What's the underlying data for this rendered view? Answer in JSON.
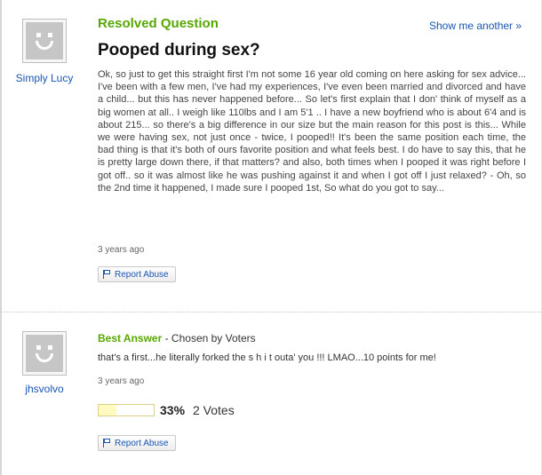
{
  "question": {
    "heading": "Resolved Question",
    "show_another": "Show me another »",
    "title": "Pooped during sex?",
    "asker": "Simply Lucy",
    "body": "Ok, so just to get this straight first I'm not some 16 year old coming on here asking for sex advice... I've been with a few men, I've had my experiences, I've even been married and divorced and have a child... but this has never happened before... So let's first explain that I don' think of myself as a big women at all.. I weigh like 110lbs and I am 5'1 .. I have a new boyfriend who is about 6'4 and is about 215... so there's a big difference in our size but the main reason for this post is this... While we were having sex, not just once - twice, I pooped!! It's been the same position each time, the bad thing is that it's both of ours favorite position and what feels best. I do have to say this, that he is pretty large down there, if that matters? and also, both times when I pooped it was right before I got off.. so it was almost like he was pushing against it and when I got off I just relaxed? - Oh, so the 2nd time it happened, I made sure I pooped 1st, So what do you got to say...",
    "time": "3 years ago",
    "report_label": "Report Abuse"
  },
  "best_answer": {
    "label": "Best Answer",
    "chosen_by": "- Chosen by Voters",
    "answerer": "jhsvolvo",
    "body": "that's a first...he literally forked the s h i t outa' you !!! LMAO...10 points for me!",
    "time": "3 years ago",
    "vote_percent_value": 0.33,
    "vote_percent": "33%",
    "votes": "2 Votes",
    "report_label": "Report Abuse"
  },
  "colors": {
    "accent_green": "#58a700",
    "link_blue": "#1a56b3",
    "vote_fill": "#fffbc0"
  }
}
